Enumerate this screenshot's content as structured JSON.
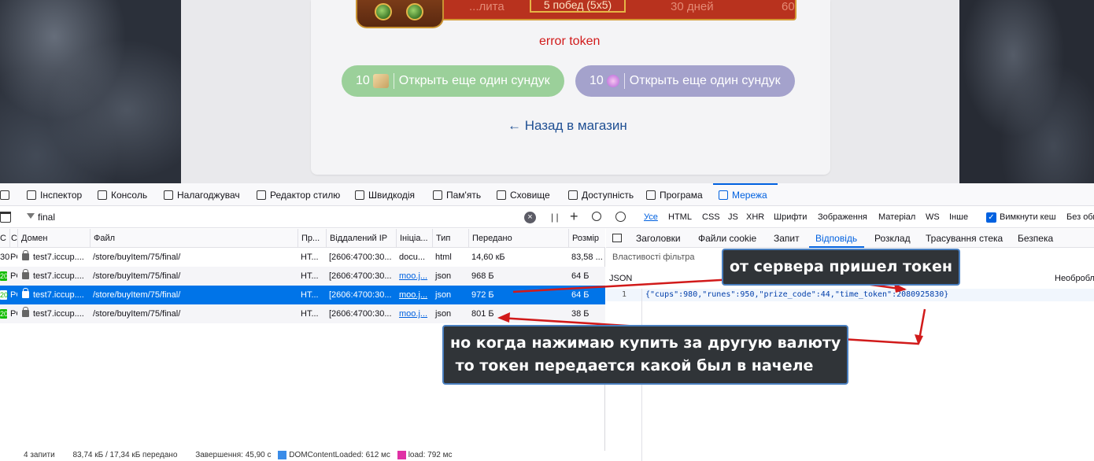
{
  "game": {
    "banner_left": "...лита",
    "banner_mid": "5 побед (5x5)",
    "banner_right": "30 дней",
    "banner_far": "60",
    "error": "error token",
    "buy_cups": {
      "amount": "10",
      "label": "Открыть еще один сундук"
    },
    "buy_runes": {
      "amount": "10",
      "label": "Открыть еще один сундук"
    },
    "back_link": "← Назад в магазин"
  },
  "devtools": {
    "tabs": [
      {
        "label": "Інспектор",
        "icon": "inspector-icon"
      },
      {
        "label": "Консоль",
        "icon": "console-icon"
      },
      {
        "label": "Налагоджувач",
        "icon": "debugger-icon"
      },
      {
        "label": "Редактор стилю",
        "icon": "style-editor-icon"
      },
      {
        "label": "Швидкодія",
        "icon": "performance-icon"
      },
      {
        "label": "Пам'ять",
        "icon": "memory-icon"
      },
      {
        "label": "Сховище",
        "icon": "storage-icon"
      },
      {
        "label": "Доступність",
        "icon": "accessibility-icon"
      },
      {
        "label": "Програма",
        "icon": "application-icon"
      },
      {
        "label": "Мережа",
        "icon": "network-icon"
      }
    ],
    "filter_value": "final",
    "type_filters": [
      "Усе",
      "HTML",
      "CSS",
      "JS",
      "XHR",
      "Шрифти",
      "Зображення",
      "Матеріал",
      "WS",
      "Інше"
    ],
    "cache_label": "Вимкнути кеш",
    "throttle_label": "Без обм",
    "columns": [
      "С",
      "С",
      "Домен",
      "Файл",
      "Пр...",
      "Віддалений IP",
      "Ініціа...",
      "Тип",
      "Передано",
      "Розмір"
    ],
    "rows": [
      {
        "status": "30",
        "method": "PO",
        "domain": "test7.iccup....",
        "file": "/store/buyItem/75/final/",
        "proto": "HT...",
        "ip": "[2606:4700:30...",
        "initiator": "docu...",
        "type": "html",
        "transferred": "14,60 кБ",
        "size": "83,58 ..."
      },
      {
        "status": "20",
        "method": "PO",
        "domain": "test7.iccup....",
        "file": "/store/buyItem/75/final/",
        "proto": "HT...",
        "ip": "[2606:4700:30...",
        "initiator": "moo.j...",
        "type": "json",
        "transferred": "968 Б",
        "size": "64 Б"
      },
      {
        "status": "20",
        "method": "PO",
        "domain": "test7.iccup....",
        "file": "/store/buyItem/75/final/",
        "proto": "HT...",
        "ip": "[2606:4700:30...",
        "initiator": "moo.j...",
        "type": "json",
        "transferred": "972 Б",
        "size": "64 Б"
      },
      {
        "status": "20",
        "method": "PO",
        "domain": "test7.iccup....",
        "file": "/store/buyItem/75/final/",
        "proto": "HT...",
        "ip": "[2606:4700:30...",
        "initiator": "moo.j...",
        "type": "json",
        "transferred": "801 Б",
        "size": "38 Б"
      }
    ],
    "status_bar": {
      "requests": "4 запити",
      "transferred": "83,74 кБ / 17,34 кБ передано",
      "finished": "Завершення: 45,90 с",
      "dom_loaded": "DOMContentLoaded: 612 мс",
      "load": "load: 792 мс"
    },
    "response_tabs": [
      "Заголовки",
      "Файли cookie",
      "Запит",
      "Відповідь",
      "Розклад",
      "Трасування стека",
      "Безпека"
    ],
    "prop_filter_placeholder": "Властивості фільтра",
    "json_label": "JSON",
    "raw_label": "Необробл",
    "line_number": "1",
    "json_text": "{\"cups\":980,\"runes\":950,\"prize_code\":44,\"time_token\":2080925830}"
  },
  "annotations": {
    "top": "от сервера пришел токен",
    "bottom_line1": "но когда нажимаю купить за другую валюту",
    "bottom_line2": " то токен передается какой был в начеле"
  },
  "colors": {
    "accent": "#0061e0",
    "arrow": "#d11a1a",
    "error": "#d11a1a",
    "cups_button": "#9bd09a",
    "runes_button": "#a4a2cc"
  }
}
